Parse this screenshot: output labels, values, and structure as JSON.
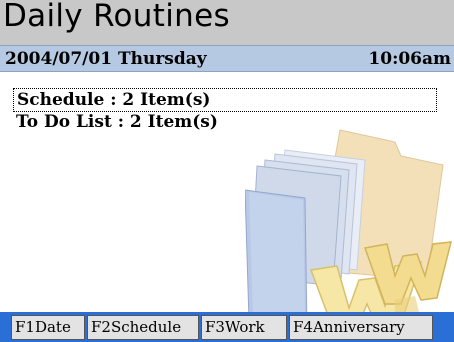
{
  "app": {
    "title": "Daily Routines"
  },
  "status": {
    "date": "2004/07/01 Thursday",
    "time": "10:06am"
  },
  "items": {
    "schedule": "Schedule : 2 Item(s)",
    "todo": "To Do List : 2 Item(s)"
  },
  "function_keys": {
    "f1": "F1Date",
    "f2": "F2Schedule",
    "f3": "F3Work",
    "f4": "F4Anniversary"
  },
  "illustration": {
    "icon": "folder-with-w-letters-icon"
  },
  "colors": {
    "title_bar": "#c8c8c8",
    "date_bar": "#b6c9e2",
    "function_bar": "#2a6fd6",
    "function_key": "#e3e3e3"
  }
}
